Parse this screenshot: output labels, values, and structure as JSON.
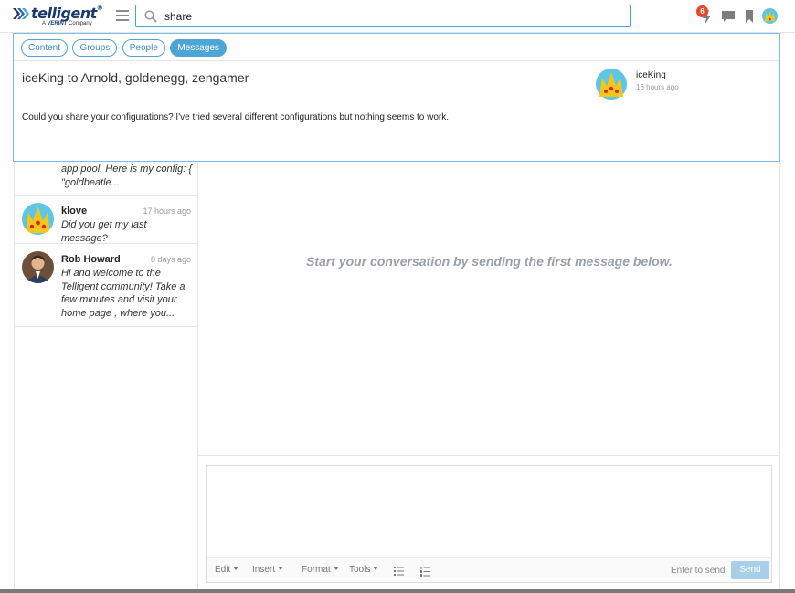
{
  "header": {
    "logo_word": "telligent",
    "logo_tm": "®",
    "logo_sub_prefix": "A",
    "logo_sub_brand": "VERINT",
    "logo_sub_suffix": "Company",
    "search_value": "share",
    "notification_count": "6"
  },
  "search_results": {
    "filters": [
      {
        "label": "Content",
        "active": false
      },
      {
        "label": "Groups",
        "active": false
      },
      {
        "label": "People",
        "active": false
      },
      {
        "label": "Messages",
        "active": true
      }
    ],
    "result": {
      "title": "iceKing to Arnold, goldenegg, zengamer",
      "author": "iceKing",
      "time": "16 hours ago",
      "body": "Could you share your configurations? I've tried several different configurations but nothing seems to work."
    }
  },
  "conversations": [
    {
      "name": "",
      "time": "",
      "preview": "app pool. Here is my config: { \"goldbeatle..."
    },
    {
      "name": "klove",
      "time": "17 hours ago",
      "preview": "Did you get my last message?"
    },
    {
      "name": "Rob Howard",
      "time": "8 days ago",
      "preview": "Hi and welcome to the Telligent community! Take a few minutes and visit your home page , where you..."
    }
  ],
  "main": {
    "empty_message": "Start your conversation by sending the first message below."
  },
  "composer": {
    "toolbar": {
      "edit": "Edit",
      "insert": "Insert",
      "format": "Format",
      "tools": "Tools"
    },
    "enter_to_send": "Enter to send",
    "send_label": "Send"
  }
}
